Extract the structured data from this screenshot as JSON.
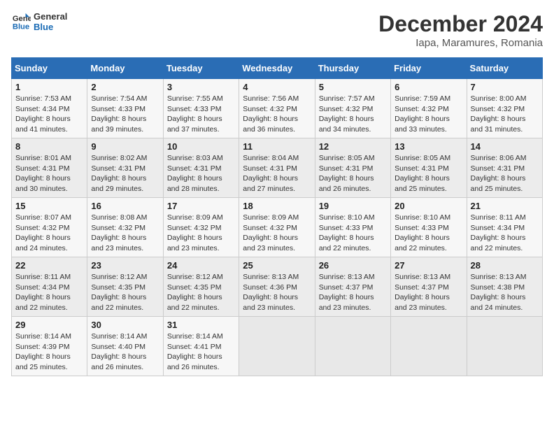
{
  "header": {
    "logo_line1": "General",
    "logo_line2": "Blue",
    "month_title": "December 2024",
    "subtitle": "Iapa, Maramures, Romania"
  },
  "days_of_week": [
    "Sunday",
    "Monday",
    "Tuesday",
    "Wednesday",
    "Thursday",
    "Friday",
    "Saturday"
  ],
  "weeks": [
    [
      {
        "day": "1",
        "sunrise": "Sunrise: 7:53 AM",
        "sunset": "Sunset: 4:34 PM",
        "daylight": "Daylight: 8 hours and 41 minutes."
      },
      {
        "day": "2",
        "sunrise": "Sunrise: 7:54 AM",
        "sunset": "Sunset: 4:33 PM",
        "daylight": "Daylight: 8 hours and 39 minutes."
      },
      {
        "day": "3",
        "sunrise": "Sunrise: 7:55 AM",
        "sunset": "Sunset: 4:33 PM",
        "daylight": "Daylight: 8 hours and 37 minutes."
      },
      {
        "day": "4",
        "sunrise": "Sunrise: 7:56 AM",
        "sunset": "Sunset: 4:32 PM",
        "daylight": "Daylight: 8 hours and 36 minutes."
      },
      {
        "day": "5",
        "sunrise": "Sunrise: 7:57 AM",
        "sunset": "Sunset: 4:32 PM",
        "daylight": "Daylight: 8 hours and 34 minutes."
      },
      {
        "day": "6",
        "sunrise": "Sunrise: 7:59 AM",
        "sunset": "Sunset: 4:32 PM",
        "daylight": "Daylight: 8 hours and 33 minutes."
      },
      {
        "day": "7",
        "sunrise": "Sunrise: 8:00 AM",
        "sunset": "Sunset: 4:32 PM",
        "daylight": "Daylight: 8 hours and 31 minutes."
      }
    ],
    [
      {
        "day": "8",
        "sunrise": "Sunrise: 8:01 AM",
        "sunset": "Sunset: 4:31 PM",
        "daylight": "Daylight: 8 hours and 30 minutes."
      },
      {
        "day": "9",
        "sunrise": "Sunrise: 8:02 AM",
        "sunset": "Sunset: 4:31 PM",
        "daylight": "Daylight: 8 hours and 29 minutes."
      },
      {
        "day": "10",
        "sunrise": "Sunrise: 8:03 AM",
        "sunset": "Sunset: 4:31 PM",
        "daylight": "Daylight: 8 hours and 28 minutes."
      },
      {
        "day": "11",
        "sunrise": "Sunrise: 8:04 AM",
        "sunset": "Sunset: 4:31 PM",
        "daylight": "Daylight: 8 hours and 27 minutes."
      },
      {
        "day": "12",
        "sunrise": "Sunrise: 8:05 AM",
        "sunset": "Sunset: 4:31 PM",
        "daylight": "Daylight: 8 hours and 26 minutes."
      },
      {
        "day": "13",
        "sunrise": "Sunrise: 8:05 AM",
        "sunset": "Sunset: 4:31 PM",
        "daylight": "Daylight: 8 hours and 25 minutes."
      },
      {
        "day": "14",
        "sunrise": "Sunrise: 8:06 AM",
        "sunset": "Sunset: 4:31 PM",
        "daylight": "Daylight: 8 hours and 25 minutes."
      }
    ],
    [
      {
        "day": "15",
        "sunrise": "Sunrise: 8:07 AM",
        "sunset": "Sunset: 4:32 PM",
        "daylight": "Daylight: 8 hours and 24 minutes."
      },
      {
        "day": "16",
        "sunrise": "Sunrise: 8:08 AM",
        "sunset": "Sunset: 4:32 PM",
        "daylight": "Daylight: 8 hours and 23 minutes."
      },
      {
        "day": "17",
        "sunrise": "Sunrise: 8:09 AM",
        "sunset": "Sunset: 4:32 PM",
        "daylight": "Daylight: 8 hours and 23 minutes."
      },
      {
        "day": "18",
        "sunrise": "Sunrise: 8:09 AM",
        "sunset": "Sunset: 4:32 PM",
        "daylight": "Daylight: 8 hours and 23 minutes."
      },
      {
        "day": "19",
        "sunrise": "Sunrise: 8:10 AM",
        "sunset": "Sunset: 4:33 PM",
        "daylight": "Daylight: 8 hours and 22 minutes."
      },
      {
        "day": "20",
        "sunrise": "Sunrise: 8:10 AM",
        "sunset": "Sunset: 4:33 PM",
        "daylight": "Daylight: 8 hours and 22 minutes."
      },
      {
        "day": "21",
        "sunrise": "Sunrise: 8:11 AM",
        "sunset": "Sunset: 4:34 PM",
        "daylight": "Daylight: 8 hours and 22 minutes."
      }
    ],
    [
      {
        "day": "22",
        "sunrise": "Sunrise: 8:11 AM",
        "sunset": "Sunset: 4:34 PM",
        "daylight": "Daylight: 8 hours and 22 minutes."
      },
      {
        "day": "23",
        "sunrise": "Sunrise: 8:12 AM",
        "sunset": "Sunset: 4:35 PM",
        "daylight": "Daylight: 8 hours and 22 minutes."
      },
      {
        "day": "24",
        "sunrise": "Sunrise: 8:12 AM",
        "sunset": "Sunset: 4:35 PM",
        "daylight": "Daylight: 8 hours and 22 minutes."
      },
      {
        "day": "25",
        "sunrise": "Sunrise: 8:13 AM",
        "sunset": "Sunset: 4:36 PM",
        "daylight": "Daylight: 8 hours and 23 minutes."
      },
      {
        "day": "26",
        "sunrise": "Sunrise: 8:13 AM",
        "sunset": "Sunset: 4:37 PM",
        "daylight": "Daylight: 8 hours and 23 minutes."
      },
      {
        "day": "27",
        "sunrise": "Sunrise: 8:13 AM",
        "sunset": "Sunset: 4:37 PM",
        "daylight": "Daylight: 8 hours and 23 minutes."
      },
      {
        "day": "28",
        "sunrise": "Sunrise: 8:13 AM",
        "sunset": "Sunset: 4:38 PM",
        "daylight": "Daylight: 8 hours and 24 minutes."
      }
    ],
    [
      {
        "day": "29",
        "sunrise": "Sunrise: 8:14 AM",
        "sunset": "Sunset: 4:39 PM",
        "daylight": "Daylight: 8 hours and 25 minutes."
      },
      {
        "day": "30",
        "sunrise": "Sunrise: 8:14 AM",
        "sunset": "Sunset: 4:40 PM",
        "daylight": "Daylight: 8 hours and 26 minutes."
      },
      {
        "day": "31",
        "sunrise": "Sunrise: 8:14 AM",
        "sunset": "Sunset: 4:41 PM",
        "daylight": "Daylight: 8 hours and 26 minutes."
      },
      null,
      null,
      null,
      null
    ]
  ]
}
